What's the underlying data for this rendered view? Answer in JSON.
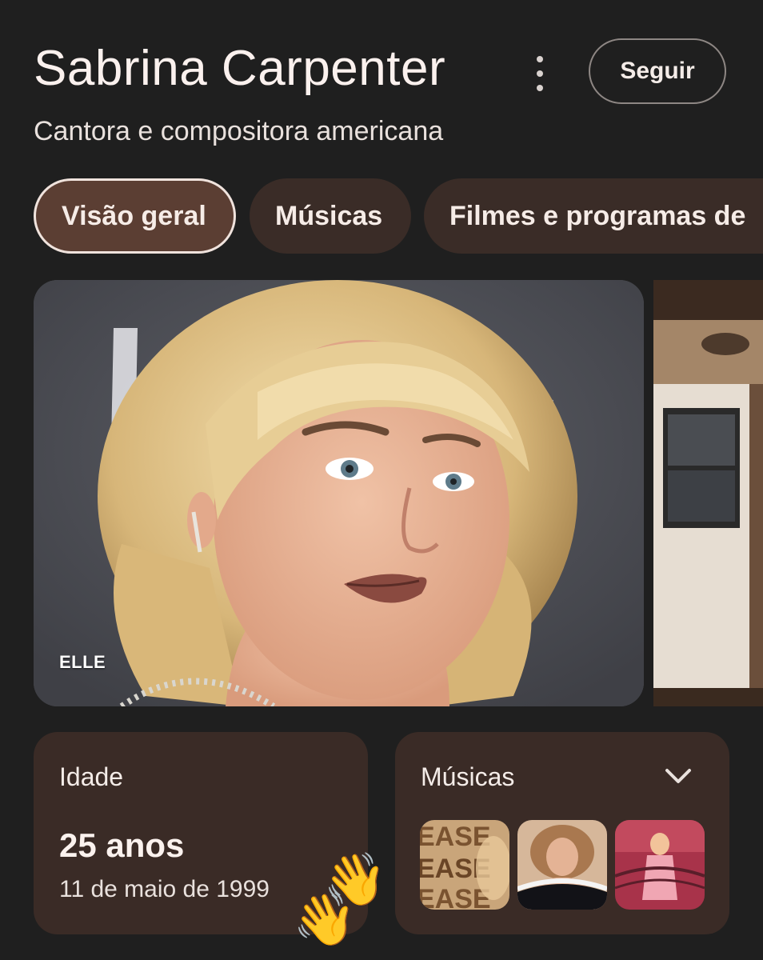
{
  "header": {
    "title": "Sabrina Carpenter",
    "subtitle": "Cantora e compositora americana",
    "follow_label": "Seguir",
    "menu_icon": "more-vert-icon"
  },
  "tabs": [
    {
      "label": "Visão geral",
      "active": true
    },
    {
      "label": "Músicas",
      "active": false
    },
    {
      "label": "Filmes e programas de",
      "active": false
    }
  ],
  "images": {
    "main_source": "ELLE"
  },
  "age_card": {
    "label": "Idade",
    "value": "25 anos",
    "birth_date": "11 de maio de 1999"
  },
  "music_card": {
    "label": "Músicas",
    "expand_icon": "chevron-down-icon",
    "thumbnails": [
      "album-cover-1",
      "album-cover-2",
      "album-cover-3"
    ]
  },
  "overlay": {
    "emoji_1": "👋",
    "emoji_2": "👋"
  },
  "colors": {
    "background": "#1f1f1f",
    "chip": "#3a2c27",
    "chip_active": "#5b3e33",
    "card": "#3a2b26"
  }
}
